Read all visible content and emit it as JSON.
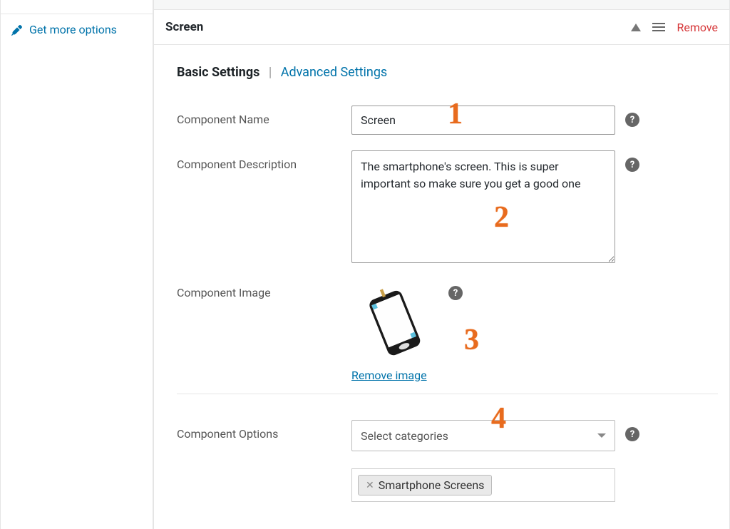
{
  "sidebar": {
    "get_more_options": "Get more options"
  },
  "panel": {
    "title": "Screen",
    "remove": "Remove"
  },
  "tabs": {
    "basic": "Basic Settings",
    "advanced": "Advanced Settings"
  },
  "fields": {
    "component_name": {
      "label": "Component Name",
      "value": "Screen"
    },
    "component_description": {
      "label": "Component Description",
      "value": "The smartphone's screen. This is super important so make sure you get a good one"
    },
    "component_image": {
      "label": "Component Image",
      "remove_link": "Remove image"
    },
    "component_options": {
      "label": "Component Options",
      "placeholder": "Select categories",
      "tags": [
        "Smartphone Screens"
      ]
    }
  },
  "annotations": {
    "one": "1",
    "two": "2",
    "three": "3",
    "four": "4"
  }
}
